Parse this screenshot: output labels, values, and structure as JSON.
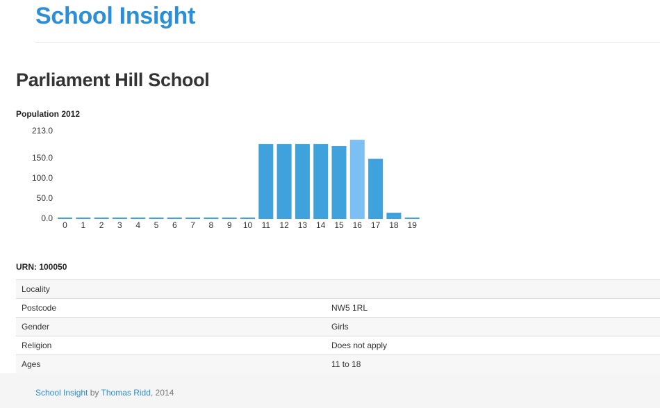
{
  "header": {
    "brand": "School Insight"
  },
  "school": {
    "name": "Parliament Hill School"
  },
  "chart_data": {
    "type": "bar",
    "title": "Population 2012",
    "categories": [
      "0",
      "1",
      "2",
      "3",
      "4",
      "5",
      "6",
      "7",
      "8",
      "9",
      "10",
      "11",
      "12",
      "13",
      "14",
      "15",
      "16",
      "17",
      "18",
      "19"
    ],
    "values": [
      0,
      0,
      0,
      0,
      0,
      0,
      0,
      0,
      0,
      0,
      0,
      181,
      181,
      181,
      181,
      176,
      191,
      145,
      15,
      0
    ],
    "y_ticks": [
      "213.0",
      "150.0",
      "100.0",
      "50.0",
      "0.0"
    ],
    "ylim": [
      0,
      213
    ],
    "highlight_index": 16,
    "colors": {
      "bar": "#3fa2dc",
      "highlight": "#7cbff2",
      "axis_text": "#333333"
    }
  },
  "urn": {
    "label": "URN: 100050"
  },
  "details": [
    {
      "key": "Locality",
      "value": ""
    },
    {
      "key": "Postcode",
      "value": "NW5 1RL"
    },
    {
      "key": "Gender",
      "value": "Girls"
    },
    {
      "key": "Religion",
      "value": "Does not apply"
    },
    {
      "key": "Ages",
      "value": "11 to 18"
    }
  ],
  "footer": {
    "site_link": "School Insight",
    "by": " by ",
    "author_link": "Thomas Ridd",
    "year": ", 2014"
  }
}
